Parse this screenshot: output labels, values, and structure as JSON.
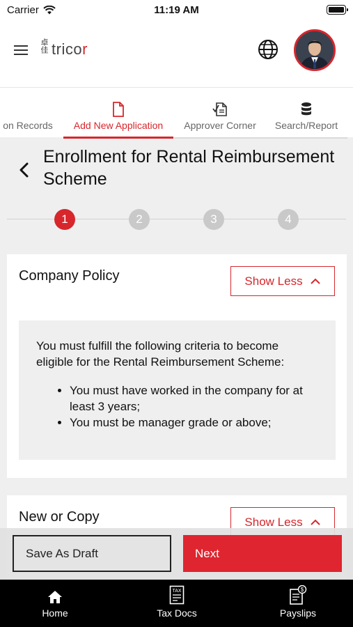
{
  "status_bar": {
    "carrier": "Carrier",
    "time": "11:19 AM"
  },
  "header": {
    "logo_text_a": "trico",
    "logo_text_b": "r",
    "logo_mark": "卓佳"
  },
  "tabs": [
    {
      "label": "on Records",
      "icon": "records-icon",
      "active": false
    },
    {
      "label": "Add New Application",
      "icon": "document-icon",
      "active": true
    },
    {
      "label": "Approver Corner",
      "icon": "approve-doc-icon",
      "active": false
    },
    {
      "label": "Search/Report",
      "icon": "database-icon",
      "active": false
    }
  ],
  "page": {
    "title": "Enrollment for Rental Reimbursement Scheme"
  },
  "stepper": {
    "steps": [
      "1",
      "2",
      "3",
      "4"
    ],
    "current": 1
  },
  "policy_card": {
    "title": "Company Policy",
    "toggle_label": "Show Less",
    "intro": "You must fulfill the following criteria to become eligible for the Rental Reimbursement Scheme:",
    "criteria": [
      "You must have worked in the company for at least 3 years;",
      "You must be manager grade or above;"
    ]
  },
  "copy_card": {
    "title": "New or Copy",
    "toggle_label": "Show Less"
  },
  "actions": {
    "draft_label": "Save As Draft",
    "next_label": "Next"
  },
  "bottom_nav": [
    {
      "label": "Home",
      "icon": "home-icon"
    },
    {
      "label": "Tax Docs",
      "icon": "tax-docs-icon"
    },
    {
      "label": "Payslips",
      "icon": "payslips-icon"
    }
  ],
  "colors": {
    "accent": "#d7262c",
    "step_inactive": "#c9c9c9",
    "nav_bg": "#000000"
  }
}
